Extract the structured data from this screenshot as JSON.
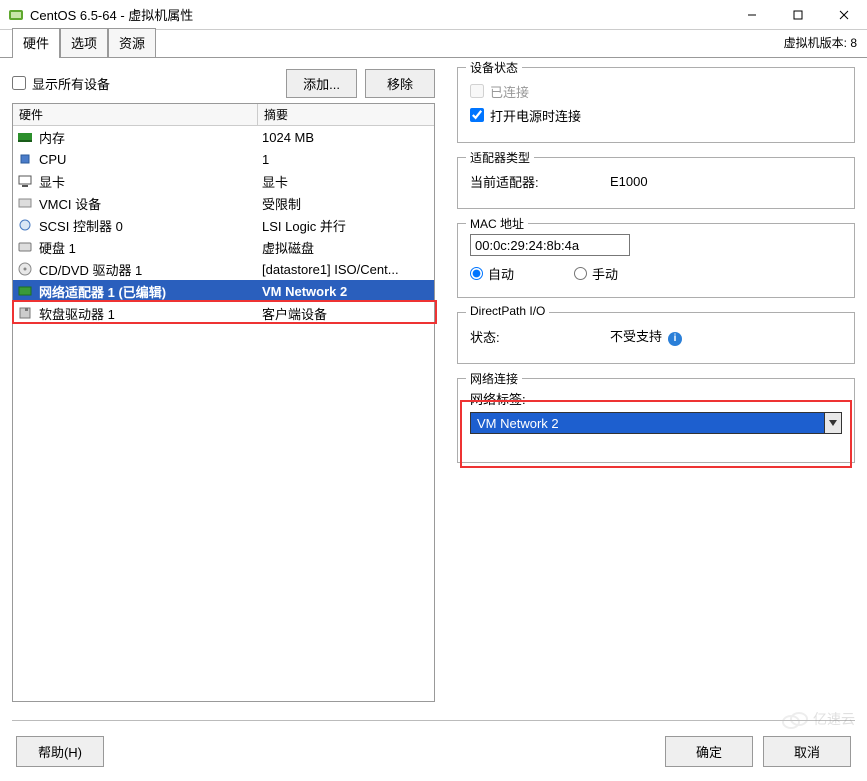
{
  "window": {
    "title": "CentOS 6.5-64 - 虚拟机属性",
    "version_text": "虚拟机版本: 8"
  },
  "tabs": [
    {
      "label": "硬件",
      "active": true
    },
    {
      "label": "选项",
      "active": false
    },
    {
      "label": "资源",
      "active": false
    }
  ],
  "left": {
    "show_all_label": "显示所有设备",
    "show_all_checked": false,
    "add_btn": "添加...",
    "remove_btn": "移除",
    "cols": {
      "hardware": "硬件",
      "summary": "摘要"
    },
    "rows": [
      {
        "icon": "memory-icon",
        "name": "内存",
        "summary": "1024 MB"
      },
      {
        "icon": "cpu-icon",
        "name": "CPU",
        "summary": "1"
      },
      {
        "icon": "video-icon",
        "name": "显卡",
        "summary": "显卡"
      },
      {
        "icon": "vmci-icon",
        "name": "VMCI 设备",
        "summary": "受限制"
      },
      {
        "icon": "scsi-icon",
        "name": "SCSI 控制器 0",
        "summary": "LSI Logic 并行"
      },
      {
        "icon": "disk-icon",
        "name": "硬盘 1",
        "summary": "虚拟磁盘"
      },
      {
        "icon": "cd-icon",
        "name": "CD/DVD 驱动器 1",
        "summary": "[datastore1] ISO/Cent..."
      },
      {
        "icon": "nic-icon",
        "name": "网络适配器 1 (已编辑)",
        "summary": "VM Network 2",
        "selected": true
      },
      {
        "icon": "floppy-icon",
        "name": "软盘驱动器 1",
        "summary": "客户端设备"
      }
    ]
  },
  "right": {
    "device_status": {
      "legend": "设备状态",
      "connected_label": "已连接",
      "connected_checked": false,
      "connected_disabled": true,
      "power_on_label": "打开电源时连接",
      "power_on_checked": true
    },
    "adapter_type": {
      "legend": "适配器类型",
      "current_label": "当前适配器:",
      "current_value": "E1000"
    },
    "mac": {
      "legend": "MAC 地址",
      "value": "00:0c:29:24:8b:4a",
      "auto_label": "自动",
      "manual_label": "手动",
      "selected": "auto"
    },
    "directpath": {
      "legend": "DirectPath I/O",
      "status_label": "状态:",
      "status_value": "不受支持"
    },
    "network": {
      "legend": "网络连接",
      "label": "网络标签:",
      "value": "VM Network 2"
    }
  },
  "buttons": {
    "help": "帮助(H)",
    "ok": "确定",
    "cancel": "取消"
  },
  "watermark": "亿速云"
}
